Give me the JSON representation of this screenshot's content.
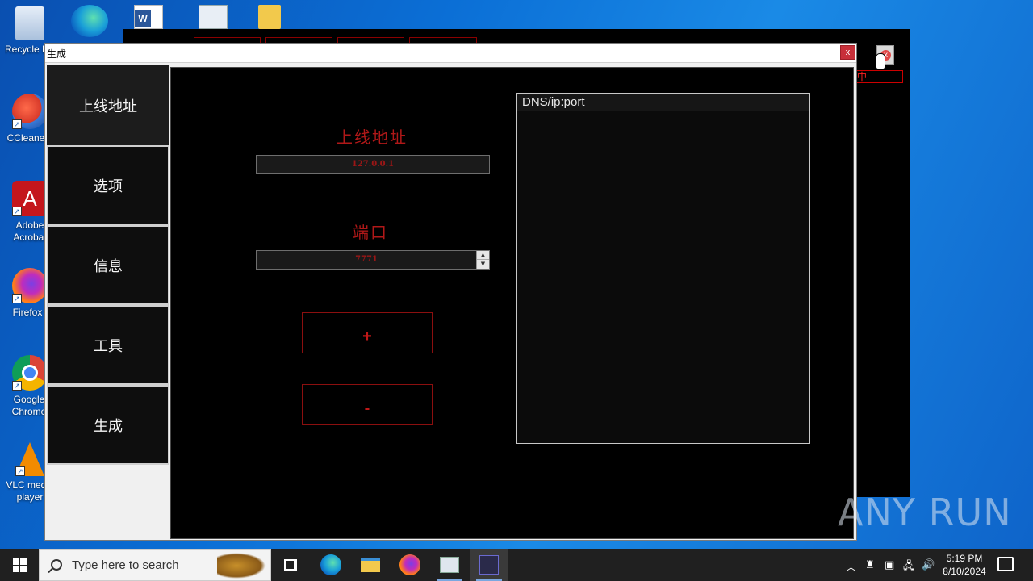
{
  "desktop": {
    "icons": [
      {
        "label": "Recycle Bin"
      },
      {
        "label": "CCleaner"
      },
      {
        "label": "Adobe Acrobat"
      },
      {
        "label": "Firefox"
      },
      {
        "label": "Google Chrome"
      },
      {
        "label": "VLC media player"
      }
    ]
  },
  "background_window": {
    "red_field_text": "中",
    "close_glyph": "x"
  },
  "dialog": {
    "title": "生成",
    "close_label": "x",
    "sidebar": {
      "items": [
        {
          "label": "上线地址",
          "active": true
        },
        {
          "label": "选项"
        },
        {
          "label": "信息"
        },
        {
          "label": "工具"
        },
        {
          "label": "生成"
        }
      ]
    },
    "main": {
      "address_label": "上线地址",
      "address_value": "127.0.0.1",
      "port_label": "端口",
      "port_value": "7771",
      "add_button": "+",
      "remove_button": "-",
      "list_header": "DNS/ip:port"
    }
  },
  "watermark": "ANY RUN",
  "taskbar": {
    "search_placeholder": "Type here to search",
    "time": "5:19 PM",
    "date": "8/10/2024"
  },
  "colors": {
    "accent_red": "#b01818",
    "desktop_blue": "#0b6fd6",
    "taskbar": "#202020"
  }
}
